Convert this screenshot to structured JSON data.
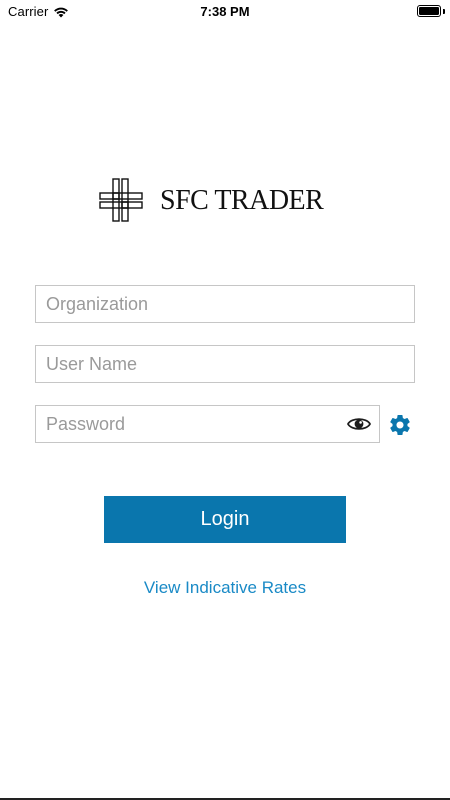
{
  "status_bar": {
    "carrier": "Carrier",
    "time": "7:38 PM",
    "battery_level": 1.0
  },
  "logo": {
    "text": "SFC TRADER",
    "icon": "cross-logo-icon"
  },
  "form": {
    "organization": {
      "placeholder": "Organization",
      "value": ""
    },
    "username": {
      "placeholder": "User Name",
      "value": ""
    },
    "password": {
      "placeholder": "Password",
      "value": ""
    },
    "show_password_icon": "eye-icon",
    "settings_icon": "gear-icon"
  },
  "actions": {
    "login_label": "Login",
    "rates_link_label": "View Indicative Rates"
  },
  "colors": {
    "primary_button": "#0a76ad",
    "link": "#1a8ac6",
    "gear": "#0a76ad"
  }
}
